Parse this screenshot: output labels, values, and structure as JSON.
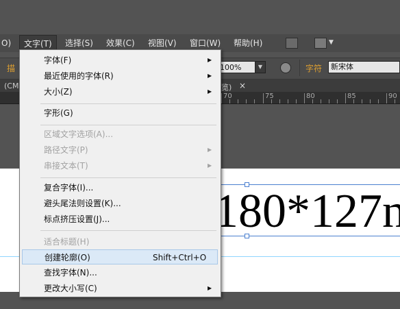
{
  "menubar": {
    "items": [
      "O)",
      "文字(T)",
      "选择(S)",
      "效果(C)",
      "视图(V)",
      "窗口(W)",
      "帮助(H)"
    ]
  },
  "controlbar": {
    "left_label": "描",
    "zoom": "100%",
    "char_label": "字符",
    "font_name": "新宋体"
  },
  "tabs": {
    "left_tab": "(CM",
    "doc_tab_suffix": "览)",
    "close": "×"
  },
  "ruler": {
    "labels": [
      "70",
      "75",
      "80",
      "85",
      "90"
    ]
  },
  "artboard": {
    "text": "180*127n"
  },
  "type_menu": {
    "items": [
      {
        "label": "字体(F)",
        "shortcut": "",
        "submenu": true,
        "disabled": false
      },
      {
        "label": "最近使用的字体(R)",
        "shortcut": "",
        "submenu": true,
        "disabled": false
      },
      {
        "label": "大小(Z)",
        "shortcut": "",
        "submenu": true,
        "disabled": false
      },
      {
        "label": "字形(G)",
        "shortcut": "",
        "submenu": false,
        "disabled": false
      },
      {
        "label": "区域文字选项(A)...",
        "shortcut": "",
        "submenu": false,
        "disabled": true
      },
      {
        "label": "路径文字(P)",
        "shortcut": "",
        "submenu": true,
        "disabled": true
      },
      {
        "label": "串接文本(T)",
        "shortcut": "",
        "submenu": true,
        "disabled": true
      },
      {
        "label": "复合字体(I)...",
        "shortcut": "",
        "submenu": false,
        "disabled": false
      },
      {
        "label": "避头尾法则设置(K)...",
        "shortcut": "",
        "submenu": false,
        "disabled": false
      },
      {
        "label": "标点挤压设置(J)...",
        "shortcut": "",
        "submenu": false,
        "disabled": false
      },
      {
        "label": "适合标题(H)",
        "shortcut": "",
        "submenu": false,
        "disabled": true
      },
      {
        "label": "创建轮廓(O)",
        "shortcut": "Shift+Ctrl+O",
        "submenu": false,
        "disabled": false,
        "highlighted": true
      },
      {
        "label": "查找字体(N)...",
        "shortcut": "",
        "submenu": false,
        "disabled": false
      },
      {
        "label": "更改大小写(C)",
        "shortcut": "",
        "submenu": true,
        "disabled": false
      }
    ]
  }
}
